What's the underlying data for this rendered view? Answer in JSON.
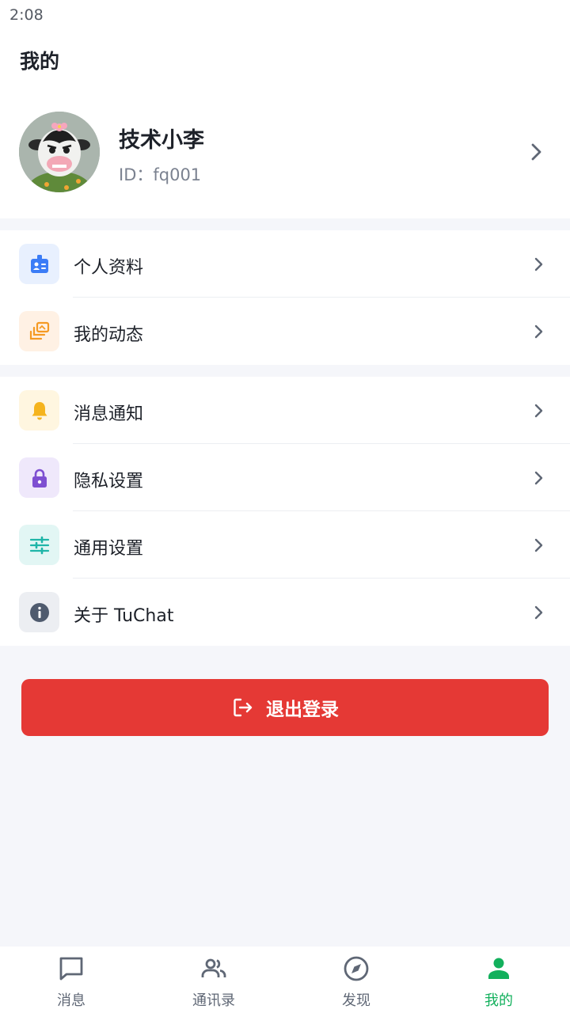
{
  "status_bar": {
    "time": "2:08"
  },
  "header": {
    "title": "我的"
  },
  "profile": {
    "name": "技术小李",
    "id_text": "ID：fq001"
  },
  "menu_groups": [
    {
      "items": [
        {
          "label": "个人资料",
          "icon": "id-badge-icon",
          "color": "#3b7cf6",
          "bg": "#e8f0fe"
        },
        {
          "label": "我的动态",
          "icon": "photo-stack-icon",
          "color": "#f59a23",
          "bg": "#fff1e4"
        }
      ]
    },
    {
      "items": [
        {
          "label": "消息通知",
          "icon": "bell-icon",
          "color": "#f5b41e",
          "bg": "#fff6e0"
        },
        {
          "label": "隐私设置",
          "icon": "lock-icon",
          "color": "#7e4fd1",
          "bg": "#efe8fb"
        },
        {
          "label": "通用设置",
          "icon": "sliders-icon",
          "color": "#1fb5a8",
          "bg": "#e2f6f4"
        },
        {
          "label": "关于 TuChat",
          "icon": "info-icon",
          "color": "#4f5b6e",
          "bg": "#eceef2"
        }
      ]
    }
  ],
  "logout": {
    "label": "退出登录",
    "icon": "logout-icon",
    "color": "#e53935"
  },
  "tabs": [
    {
      "label": "消息",
      "icon": "chat-bubble-icon",
      "active": false
    },
    {
      "label": "通讯录",
      "icon": "contacts-icon",
      "active": false
    },
    {
      "label": "发现",
      "icon": "compass-icon",
      "active": false
    },
    {
      "label": "我的",
      "icon": "person-icon",
      "active": true
    }
  ],
  "colors": {
    "accent": "#12b05c",
    "danger": "#e53935",
    "background": "#f5f6fa",
    "text": "#1d2129"
  }
}
